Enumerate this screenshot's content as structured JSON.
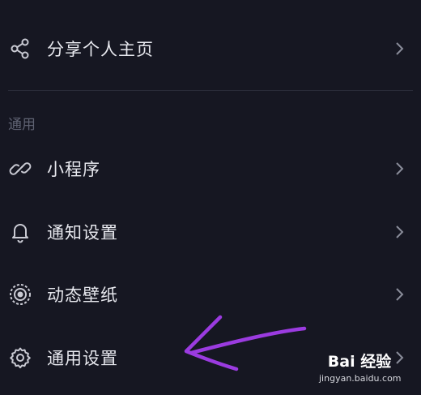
{
  "menu": {
    "share": {
      "label": "分享个人主页",
      "icon": "share-icon"
    },
    "section_title": "通用",
    "mini_program": {
      "label": "小程序",
      "icon": "link-icon"
    },
    "notifications": {
      "label": "通知设置",
      "icon": "bell-icon"
    },
    "wallpaper": {
      "label": "动态壁纸",
      "icon": "radar-icon"
    },
    "general": {
      "label": "通用设置",
      "icon": "gear-icon"
    }
  },
  "watermark": {
    "logo": "Bai 经验",
    "url": "jingyan.baidu.com"
  },
  "colors": {
    "background": "#161722",
    "text": "#e7e8ee",
    "muted": "#5f6272",
    "divider": "#2b2d3a",
    "annotation": "#9b3be0"
  }
}
